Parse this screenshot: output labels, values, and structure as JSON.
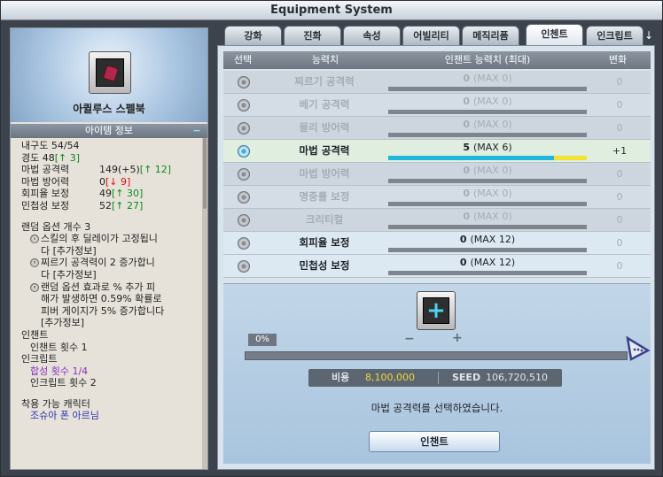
{
  "window": {
    "title": "Equipment System"
  },
  "tabs": [
    {
      "label": "강화"
    },
    {
      "label": "진화"
    },
    {
      "label": "속성"
    },
    {
      "label": "어빌리티"
    },
    {
      "label": "메직리폼"
    },
    {
      "label": "인첸트",
      "active": true
    },
    {
      "label": "인크립트"
    }
  ],
  "tab_more_arrow": "↓",
  "item": {
    "name": "아퀼루스 스펠북",
    "icon": "spellbook-icon",
    "info_title": "아이템 정보",
    "info_collapse": "−",
    "stats": {
      "durability": "내구도 54/54",
      "hardness_label": "경도 48",
      "hardness_up": "[↑ 3]",
      "mattack_label": "마법 공격력",
      "mattack_val": "149(+5)",
      "mattack_up": "[↑ 12]",
      "mdef_label": "마법 방어력",
      "mdef_val": "0",
      "mdef_down": "[↓ 9]",
      "evasion_label": "회피율 보정",
      "evasion_val": "49",
      "evasion_up": "[↑ 30]",
      "agility_label": "민첩성 보정",
      "agility_val": "52",
      "agility_up": "[↑ 27]"
    },
    "random_options": {
      "count": "랜덤 옵션 개수 3",
      "opt1_mark": "ⓢ",
      "opt1_line1": "스킬의 후 딜레이가 고정됩니",
      "opt1_line2": "다 [추가정보]",
      "opt2_mark": "ⓝ",
      "opt2_line1": "찌르기 공격력이 2 증가합니",
      "opt2_line2": "다 [추가정보]",
      "opt3_mark": "ⓝ",
      "opt3_line1": "랜덤 옵션 효과로 % 추가 피",
      "opt3_line2": "해가 발생하면 0.59% 확률로",
      "opt3_line3": "피버 게이지가 5% 증가합니다",
      "opt3_line4": "[추가정보]"
    },
    "enchant_section": "인챈트",
    "enchant_count": "인챈트 횟수  1",
    "encrypt_section": "인크립트",
    "encrypt_synthesis": "합성 횟수 1/4",
    "encrypt_count": "인크립트 횟수 2",
    "wearable_title": "착용 가능 캐릭터",
    "wearable_chars": "조슈아 폰 아르님"
  },
  "grid": {
    "headers": {
      "select": "선택",
      "ability": "능력치",
      "enchant": "인챈트 능력치 (최대)",
      "change": "변화"
    },
    "rows": [
      {
        "name": "찌르기 공격력",
        "value": "0",
        "max": "(MAX 0)",
        "fill": 0,
        "change": "0"
      },
      {
        "name": "베기 공격력",
        "value": "0",
        "max": "(MAX 0)",
        "fill": 0,
        "change": "0"
      },
      {
        "name": "물리 방어력",
        "value": "0",
        "max": "(MAX 0)",
        "fill": 0,
        "change": "0"
      },
      {
        "name": "마법 공격력",
        "value": "5",
        "max": "(MAX 6)",
        "fill": 0.833,
        "change": "+1",
        "selected": true
      },
      {
        "name": "마법 방어력",
        "value": "0",
        "max": "(MAX 0)",
        "fill": 0,
        "change": "0"
      },
      {
        "name": "명중률 보정",
        "value": "0",
        "max": "(MAX 0)",
        "fill": 0,
        "change": "0"
      },
      {
        "name": "크리티컬",
        "value": "0",
        "max": "(MAX 0)",
        "fill": 0,
        "change": "0"
      },
      {
        "name": "회피율 보정",
        "value": "0",
        "max": "(MAX 12)",
        "fill": 0,
        "change": "0",
        "enabled": true
      },
      {
        "name": "민첩성 보정",
        "value": "0",
        "max": "(MAX 12)",
        "fill": 0,
        "change": "0",
        "enabled": true
      }
    ]
  },
  "enchant_panel": {
    "progress_label": "0%",
    "progress": 0,
    "minus": "−",
    "plus": "+",
    "cost_label": "비용",
    "cost_value": "8,100,000",
    "seed_label": "SEED",
    "seed_value": "106,720,510",
    "message": "마법 공격력를 선택하였습니다.",
    "button": "인챈트"
  },
  "colors": {
    "accent": "#1fb8dc",
    "highlight": "#f2e233"
  }
}
